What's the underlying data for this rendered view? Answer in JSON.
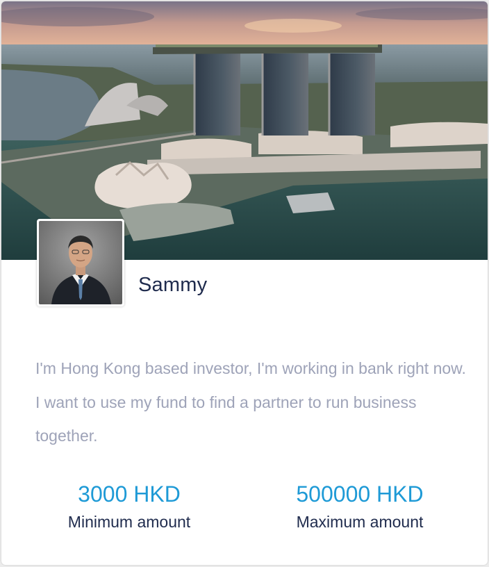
{
  "profile": {
    "name": "Sammy",
    "bio": "I'm Hong Kong based investor, I'm working in bank right now. I want to use my fund to find a partner to run business together."
  },
  "stats": [
    {
      "value": "3000 HKD",
      "label": "Minimum amount"
    },
    {
      "value": "500000 HKD",
      "label": "Maximum amount"
    }
  ],
  "images": {
    "cover": "cover-photo-marina-bay-skyline",
    "avatar": "profile-photo-man-in-suit"
  },
  "colors": {
    "accent": "#1e9ad6",
    "heading": "#1f2b4d",
    "muted": "#9ea3b8"
  }
}
